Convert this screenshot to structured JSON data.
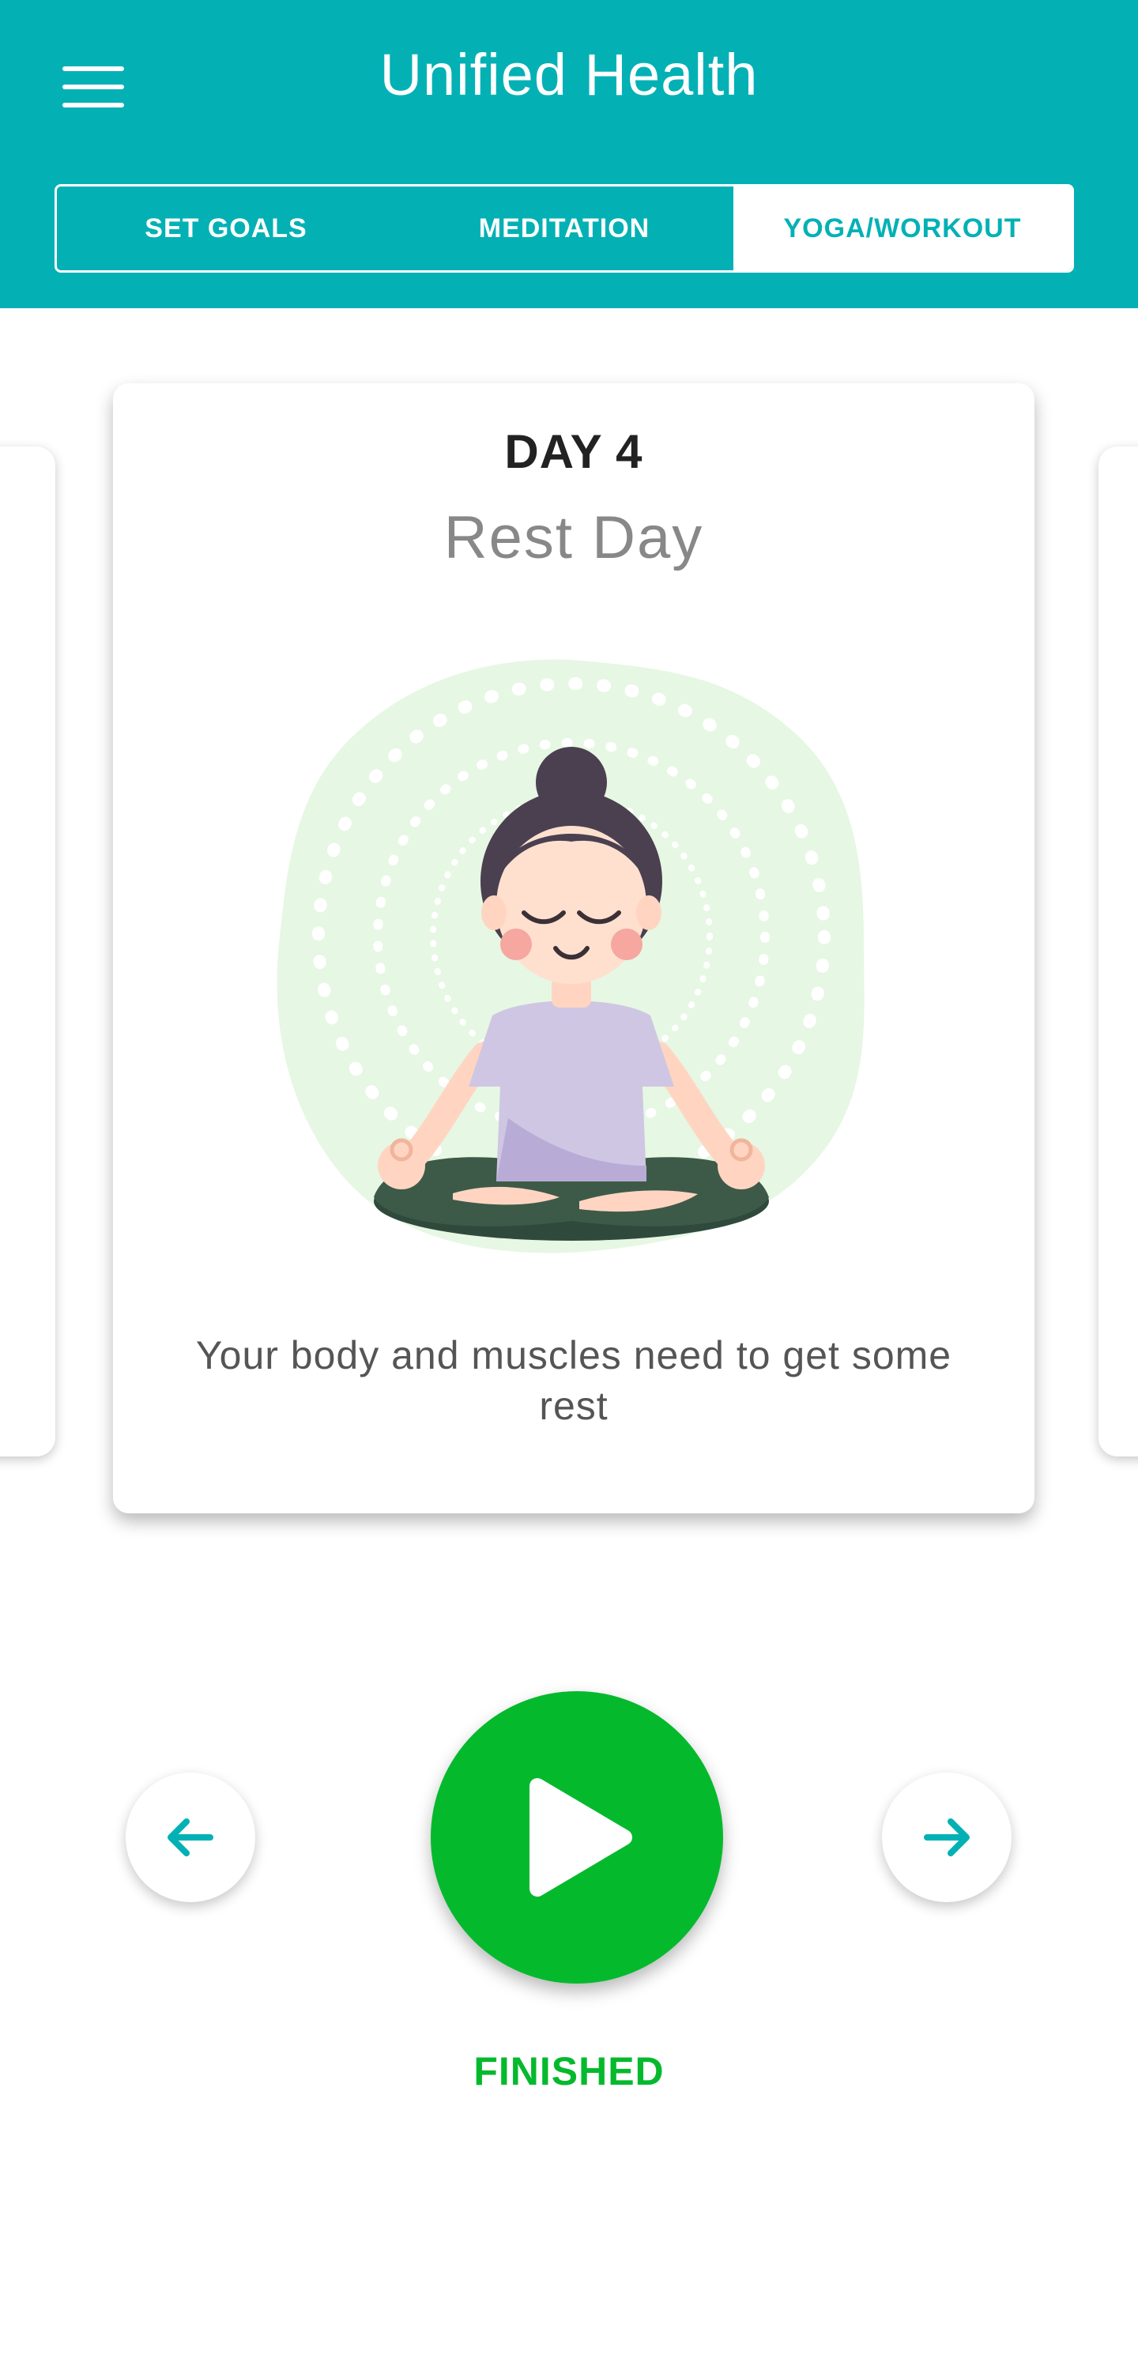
{
  "header": {
    "app_title": "Unified Health",
    "menu_icon": "hamburger-menu-icon",
    "tabs": [
      {
        "label": "SET GOALS",
        "active": false
      },
      {
        "label": "MEDITATION",
        "active": false
      },
      {
        "label": "YOGA/WORKOUT",
        "active": true
      }
    ]
  },
  "card": {
    "day": "DAY 4",
    "title": "Rest Day",
    "description": "Your body and muscles need to get some rest",
    "illustration": "meditating-woman-illustration"
  },
  "controls": {
    "prev_icon": "arrow-left-icon",
    "play_icon": "play-icon",
    "next_icon": "arrow-right-icon",
    "status": "FINISHED"
  },
  "colors": {
    "primary": "#03b1b5",
    "success": "#05b92d",
    "text_dark": "#222222",
    "text_muted": "#888888"
  }
}
